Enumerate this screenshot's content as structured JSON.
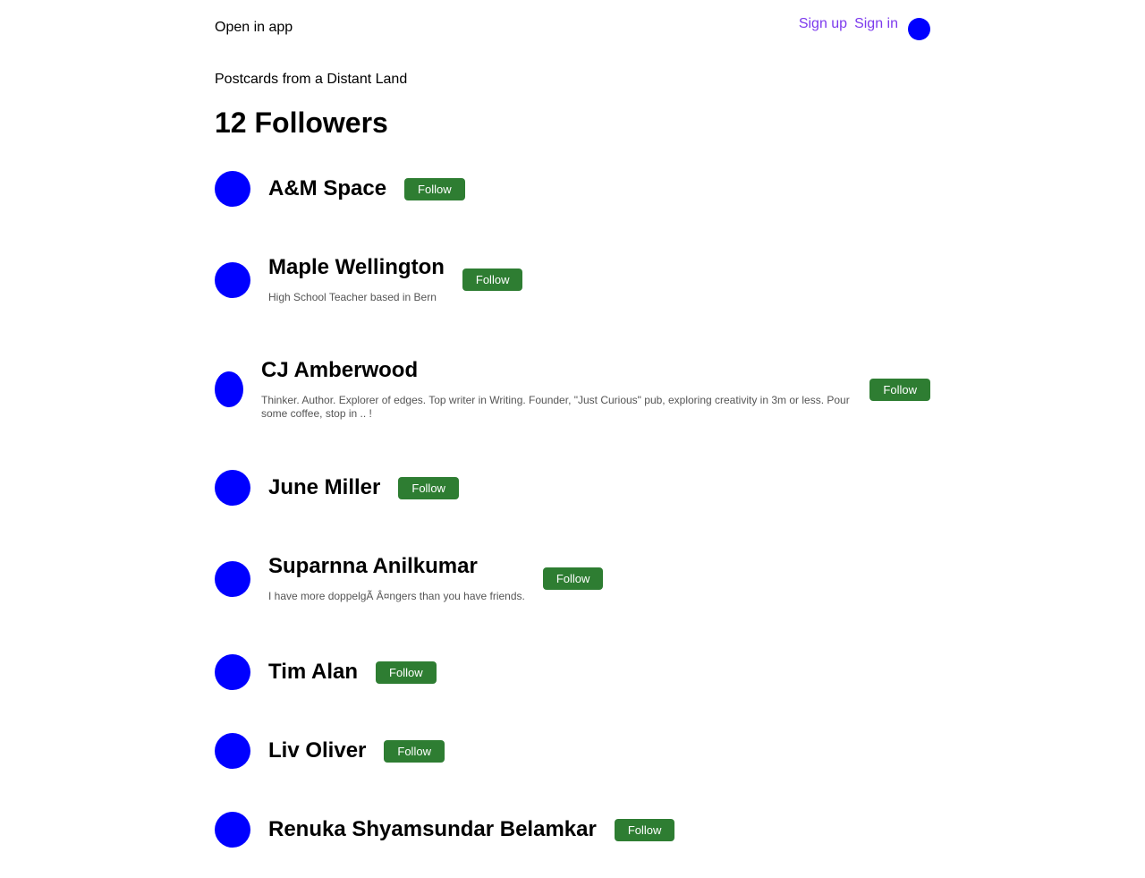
{
  "header": {
    "open_in_app": "Open in app",
    "sign_up": "Sign up",
    "sign_in": "Sign in"
  },
  "publication": "Postcards from a Distant Land",
  "title": "12 Followers",
  "follow_label": "Follow",
  "followers": [
    {
      "name": "A&M Space",
      "bio": ""
    },
    {
      "name": "Maple Wellington",
      "bio": "High School Teacher based in Bern"
    },
    {
      "name": "CJ Amberwood",
      "bio": "Thinker. Author. Explorer of edges. Top writer in Writing. Founder, \"Just Curious\" pub, exploring creativity in 3m or less. Pour some coffee, stop in .. !"
    },
    {
      "name": "June Miller",
      "bio": ""
    },
    {
      "name": "Suparnna Anilkumar",
      "bio": "I have more doppelgÃ   Â¤ngers than you have friends."
    },
    {
      "name": "Tim Alan",
      "bio": ""
    },
    {
      "name": "Liv Oliver",
      "bio": ""
    },
    {
      "name": "Renuka Shyamsundar Belamkar",
      "bio": ""
    }
  ],
  "colors": {
    "link": "#7c3aed",
    "avatar": "#0000ff",
    "follow_button": "#2e7d32"
  }
}
